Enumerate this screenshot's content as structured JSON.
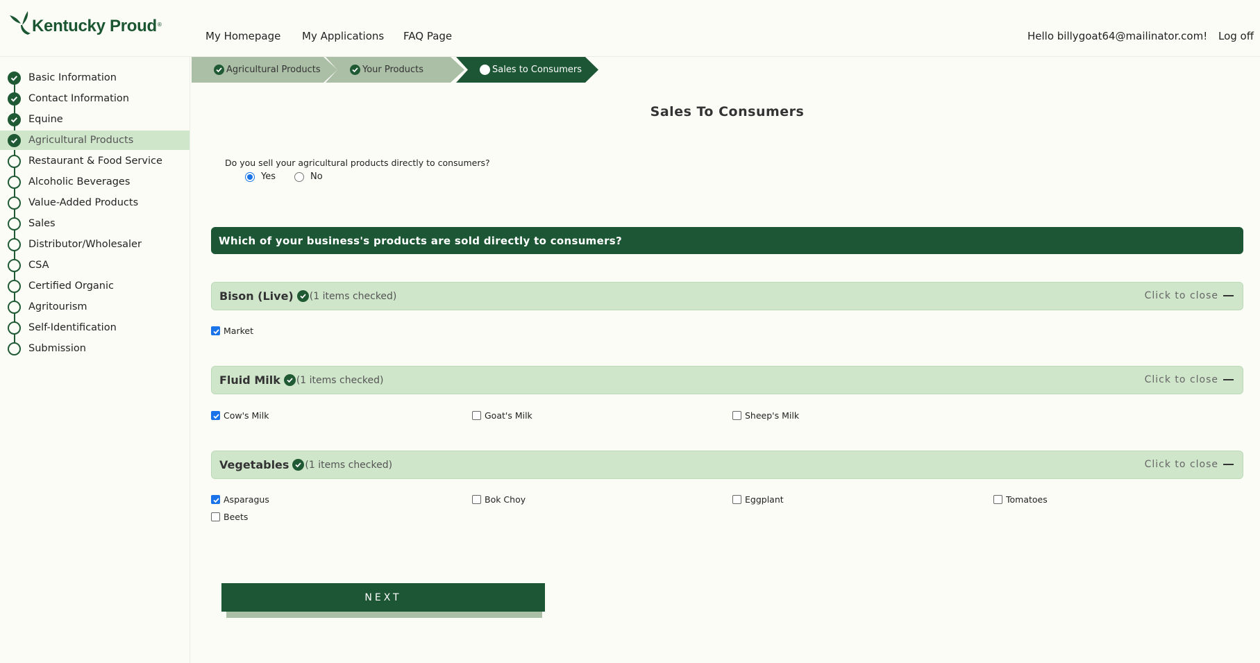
{
  "brand": {
    "name": "Kentucky Proud",
    "reg": "®"
  },
  "nav": {
    "homepage": "My Homepage",
    "applications": "My Applications",
    "faq": "FAQ Page",
    "hello": "Hello billygoat64@mailinator.com!",
    "logoff": "Log off"
  },
  "sidebar": {
    "items": [
      {
        "label": "Basic Information",
        "status": "complete"
      },
      {
        "label": "Contact Information",
        "status": "complete"
      },
      {
        "label": "Equine",
        "status": "complete"
      },
      {
        "label": "Agricultural Products",
        "status": "complete-active"
      },
      {
        "label": "Restaurant & Food Service",
        "status": "incomplete"
      },
      {
        "label": "Alcoholic Beverages",
        "status": "incomplete"
      },
      {
        "label": "Value-Added Products",
        "status": "incomplete"
      },
      {
        "label": "Sales",
        "status": "incomplete"
      },
      {
        "label": "Distributor/Wholesaler",
        "status": "incomplete"
      },
      {
        "label": "CSA",
        "status": "incomplete"
      },
      {
        "label": "Certified Organic",
        "status": "incomplete"
      },
      {
        "label": "Agritourism",
        "status": "incomplete"
      },
      {
        "label": "Self-Identification",
        "status": "incomplete"
      },
      {
        "label": "Submission",
        "status": "incomplete"
      }
    ]
  },
  "breadcrumbs": [
    {
      "label": "Agricultural Products",
      "state": "done"
    },
    {
      "label": "Your Products",
      "state": "done"
    },
    {
      "label": "Sales to Consumers",
      "state": "current"
    }
  ],
  "main": {
    "title": "Sales To Consumers",
    "question": "Do you sell your agricultural products directly to consumers?",
    "options": [
      {
        "label": "Yes",
        "selected": true
      },
      {
        "label": "No",
        "selected": false
      }
    ],
    "section_title": "Which of your business's products are sold directly to consumers?",
    "close_label": "Click to close",
    "groups": [
      {
        "name": "Bison (Live)",
        "count": "(1 items checked)",
        "items": [
          {
            "label": "Market",
            "checked": true
          }
        ]
      },
      {
        "name": "Fluid Milk",
        "count": "(1 items checked)",
        "items": [
          {
            "label": "Cow's Milk",
            "checked": true
          },
          {
            "label": "Goat's Milk",
            "checked": false
          },
          {
            "label": "Sheep's Milk",
            "checked": false
          }
        ]
      },
      {
        "name": "Vegetables",
        "count": "(1 items checked)",
        "items": [
          {
            "label": "Asparagus",
            "checked": true
          },
          {
            "label": "Bok Choy",
            "checked": false
          },
          {
            "label": "Eggplant",
            "checked": false
          },
          {
            "label": "Tomatoes",
            "checked": false
          },
          {
            "label": "Beets",
            "checked": false
          }
        ]
      }
    ],
    "next_label": "NEXT"
  },
  "colors": {
    "brand_green": "#1c5634",
    "light_green": "#cfe6cb",
    "crumb_done": "#aabfa6"
  }
}
